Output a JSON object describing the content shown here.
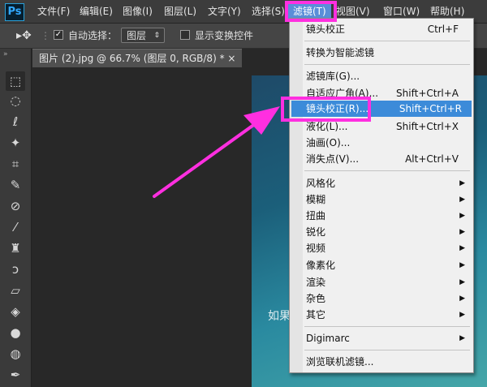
{
  "app": {
    "logo": "Ps"
  },
  "menubar": {
    "items": [
      "文件(F)",
      "编辑(E)",
      "图像(I)",
      "图层(L)",
      "文字(Y)",
      "选择(S)",
      "滤镜(T)",
      "视图(V)",
      "窗口(W)",
      "帮助(H)"
    ],
    "active": "滤镜(T)"
  },
  "options": {
    "auto_select_label": "自动选择：",
    "auto_select_checked": true,
    "auto_select_value": "图层",
    "show_transform_label": "显示变换控件"
  },
  "document": {
    "tab_title": "图片 (2).jpg @ 66.7% (图层 0, RGB/8) *",
    "tab_close": "×",
    "canvas_text": "如果"
  },
  "filter_menu": {
    "items": [
      {
        "label": "镜头校正",
        "shortcut": "Ctrl+F"
      },
      {
        "label": "转换为智能滤镜",
        "shortcut": ""
      },
      {
        "label": "滤镜库(G)...",
        "shortcut": ""
      },
      {
        "label": "自适应广角(A)...",
        "shortcut": "Shift+Ctrl+A"
      },
      {
        "label": "镜头校正(R)...",
        "shortcut": "Shift+Ctrl+R",
        "selected": true
      },
      {
        "label": "液化(L)...",
        "shortcut": "Shift+Ctrl+X"
      },
      {
        "label": "油画(O)...",
        "shortcut": ""
      },
      {
        "label": "消失点(V)...",
        "shortcut": "Alt+Ctrl+V"
      },
      {
        "label": "风格化",
        "submenu": true
      },
      {
        "label": "模糊",
        "submenu": true
      },
      {
        "label": "扭曲",
        "submenu": true
      },
      {
        "label": "锐化",
        "submenu": true
      },
      {
        "label": "视频",
        "submenu": true
      },
      {
        "label": "像素化",
        "submenu": true
      },
      {
        "label": "渲染",
        "submenu": true
      },
      {
        "label": "杂色",
        "submenu": true
      },
      {
        "label": "其它",
        "submenu": true
      },
      {
        "label": "Digimarc",
        "submenu": true
      },
      {
        "label": "浏览联机滤镜...",
        "shortcut": ""
      }
    ]
  },
  "tools": [
    "move-icon",
    "marquee-icon",
    "lasso-icon",
    "magic-wand-icon",
    "crop-icon",
    "eyedropper-icon",
    "healing-icon",
    "brush-icon",
    "clone-stamp-icon",
    "history-brush-icon",
    "eraser-icon",
    "gradient-icon",
    "blur-icon",
    "dodge-icon",
    "pen-icon"
  ],
  "colors": {
    "highlight": "#ff2fe0",
    "menu_selected": "#3c8bd9"
  }
}
